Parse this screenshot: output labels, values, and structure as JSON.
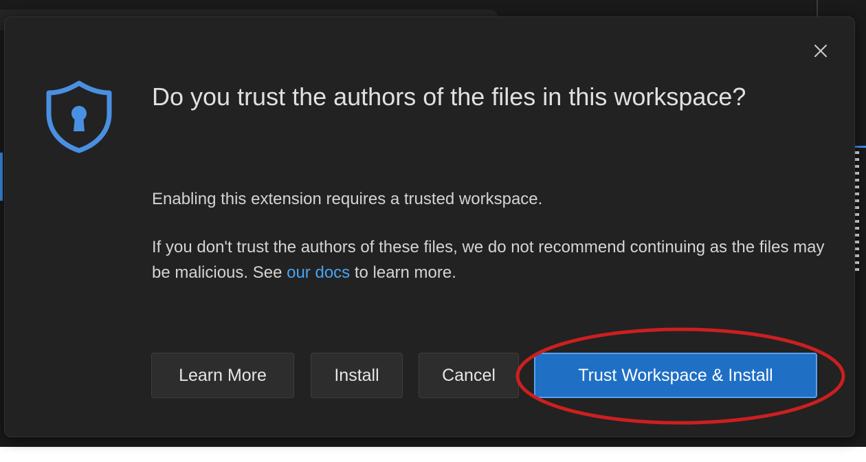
{
  "dialog": {
    "title": "Do you trust the authors of the files in this workspace?",
    "message": "Enabling this extension requires a trusted workspace.",
    "detail_before": "If you don't trust the authors of these files, we do not recommend continuing as the files may be malicious. See ",
    "detail_link": "our docs",
    "detail_after": " to learn more.",
    "close_icon": "×",
    "icon": "shield-keyhole-icon"
  },
  "buttons": {
    "learn_more": "Learn More",
    "install": "Install",
    "cancel": "Cancel",
    "trust_install": "Trust Workspace & Install"
  },
  "colors": {
    "dialog_bg": "#222222",
    "primary_button": "#1f6fc5",
    "link": "#4aa3f2",
    "shield": "#4a90e2",
    "annotation": "#cc1f1f"
  }
}
